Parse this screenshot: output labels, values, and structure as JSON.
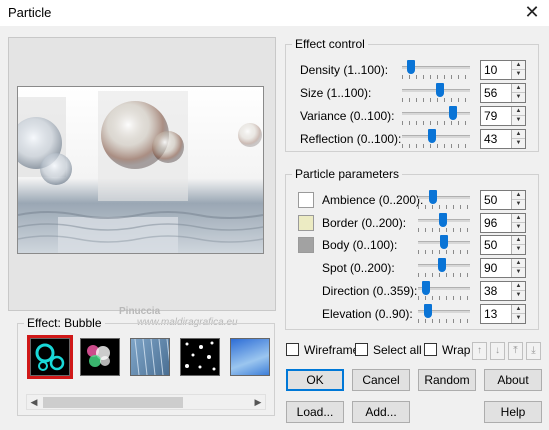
{
  "window": {
    "title": "Particle",
    "close_glyph": "✕"
  },
  "watermark": {
    "line1": "Pinuccia",
    "line2": "www.maldiragrafica.eu"
  },
  "effect_control": {
    "title": "Effect control",
    "rows": [
      {
        "label": "Density (1..100):",
        "value": "10",
        "level": 0.09
      },
      {
        "label": "Size (1..100):",
        "value": "56",
        "level": 0.56
      },
      {
        "label": "Variance (0..100):",
        "value": "79",
        "level": 0.79
      },
      {
        "label": "Reflection (0..100):",
        "value": "43",
        "level": 0.43
      }
    ]
  },
  "particle_parameters": {
    "title": "Particle parameters",
    "rows": [
      {
        "label": "Ambience (0..200):",
        "value": "50",
        "level": 0.25,
        "swatch": "#ffffff"
      },
      {
        "label": "Border (0..200):",
        "value": "96",
        "level": 0.48,
        "swatch": "#ecebc3"
      },
      {
        "label": "Body (0..100):",
        "value": "50",
        "level": 0.5,
        "swatch": "#a2a2a2"
      },
      {
        "label": "Spot (0..200):",
        "value": "90",
        "level": 0.45
      },
      {
        "label": "Direction (0..359):",
        "value": "38",
        "level": 0.1
      },
      {
        "label": "Elevation (0..90):",
        "value": "13",
        "level": 0.14
      }
    ]
  },
  "effect": {
    "label": "Effect: Bubble",
    "thumbnails": [
      {
        "name": "bubble-thumbnail",
        "selected": true
      },
      {
        "name": "sparkle-thumbnail",
        "selected": false
      },
      {
        "name": "rain-thumbnail",
        "selected": false
      },
      {
        "name": "snow-thumbnail",
        "selected": false
      },
      {
        "name": "sky-thumbnail",
        "selected": false
      }
    ]
  },
  "options": {
    "wireframe": "Wireframe",
    "select_all": "Select all",
    "wrap": "Wrap"
  },
  "arrow_icons": [
    "arrow-up-icon",
    "arrow-down-icon",
    "arrow-top-icon",
    "arrow-bottom-icon"
  ],
  "buttons": {
    "ok": "OK",
    "cancel": "Cancel",
    "random": "Random",
    "about": "About",
    "load": "Load...",
    "add": "Add...",
    "help": "Help"
  },
  "colors": {
    "accent": "#0078d7",
    "slider_thumb": "#0a74d6",
    "selection": "#d01818"
  }
}
